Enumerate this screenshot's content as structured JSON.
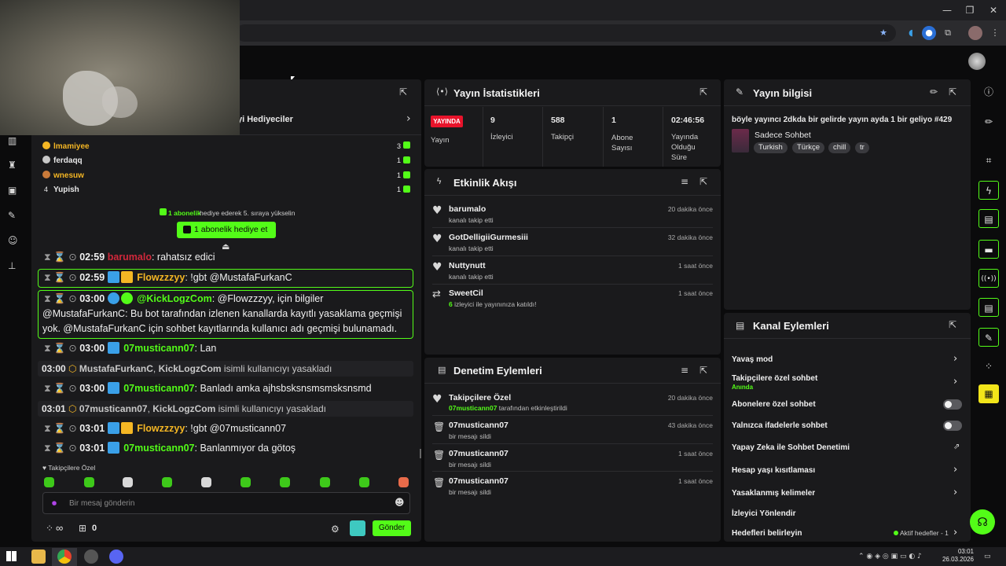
{
  "browser": {
    "minimize": "—",
    "maximize": "❐",
    "close": "✕"
  },
  "leaderboard": {
    "header": "yi Hediyeciler",
    "rows": [
      {
        "rank": "",
        "name": "lmamiyee",
        "count": "3"
      },
      {
        "rank": "",
        "name": "ferdaqq",
        "count": "1"
      },
      {
        "rank": "",
        "name": "wnesuw",
        "count": "1"
      },
      {
        "rank": "4",
        "name": "Yupish",
        "count": "1"
      }
    ],
    "promo_count": "1 abonelik",
    "promo_text": "hediye ederek 5. sıraya yükselin",
    "gift_button": "1 abonelik hediye et"
  },
  "chat": {
    "lines": [
      {
        "time": "02:59",
        "user": "barumalo",
        "msg": ": rahatsız edici"
      },
      {
        "time": "02:59",
        "user": "Flowzzzyy",
        "msg": ": !gbt @MustafaFurkanC"
      },
      {
        "time": "03:00",
        "user": "@KickLogzCom",
        "msg": ": @Flowzzzyy, için bilgiler @MustafaFurkanC: Bu bot tarafından izlenen kanallarda kayıtlı yasaklama geçmişi yok. @MustafaFurkanC için sohbet kayıtlarında kullanıcı adı geçmişi bulunamadı."
      },
      {
        "time": "03:00",
        "user": "07musticann07",
        "msg": ": Lan"
      },
      {
        "time": "03:00",
        "user": "07musticann07",
        "msg": ": Banladı amka ajhsbsksnsmsmsksnsmd"
      },
      {
        "time": "03:01",
        "user": "Flowzzzyy",
        "msg": ": !gbt @07musticann07"
      },
      {
        "time": "03:01",
        "user": "07musticann07",
        "msg": ": Banlanmıyor da götoş"
      }
    ],
    "sys1": {
      "time": "03:00",
      "a": "MustafaFurkanC",
      "b": "KickLogzCom",
      "text": "isimli kullanıcıyı yasakladı"
    },
    "sys2": {
      "time": "03:01",
      "a": "07musticann07",
      "b": "KickLogzCom",
      "text": "isimli kullanıcıyı yasakladı"
    },
    "followers_only": "Takipçilere Özel",
    "placeholder": "Bir mesaj gönderin",
    "infinity": "∞",
    "gift_count": "0",
    "send": "Gönder"
  },
  "stats": {
    "title": "Yayın İstatistikleri",
    "live": "YAYINDA",
    "live_label": "Yayın",
    "items": [
      {
        "value": "9",
        "label": "İzleyici"
      },
      {
        "value": "588",
        "label": "Takipçi"
      },
      {
        "value": "1",
        "label": "Abone Sayısı"
      },
      {
        "value": "02:46:56",
        "label": "Yayında Olduğu Süre"
      }
    ]
  },
  "activity": {
    "title": "Etkinlik Akışı",
    "items": [
      {
        "name": "barumalo",
        "sub": "kanalı takip etti",
        "time": "20 dakika önce"
      },
      {
        "name": "GotDelligiiGurmesiii",
        "sub": "kanalı takip etti",
        "time": "32 dakika önce"
      },
      {
        "name": "Nuttynutt",
        "sub": "kanalı takip etti",
        "time": "1 saat önce"
      },
      {
        "name": "SweetCil",
        "sub_num": "6",
        "sub": " izleyici ile yayınınıza katıldı!",
        "time": "1 saat önce"
      }
    ]
  },
  "moderation": {
    "title": "Denetim Eylemleri",
    "items": [
      {
        "name": "Takipçilere Özel",
        "actor": "07musticann07",
        "sub": " tarafından etkinleştirildi",
        "time": "20 dakika önce"
      },
      {
        "name": "07musticann07",
        "sub": "bir mesajı sildi",
        "time": "43 dakika önce"
      },
      {
        "name": "07musticann07",
        "sub": "bir mesajı sildi",
        "time": "1 saat önce"
      },
      {
        "name": "07musticann07",
        "sub": "bir mesajı sildi",
        "time": "1 saat önce"
      }
    ]
  },
  "info": {
    "title": "Yayın bilgisi",
    "stream_title": "böyle yayıncı 2dkda bir gelirde yayın ayda 1 bir geliyo #429",
    "category": "Sadece Sohbet",
    "tags": [
      "Turkish",
      "Türkçe",
      "chill",
      "tr"
    ]
  },
  "channel": {
    "title": "Kanal Eylemleri",
    "slow": "Yavaş mod",
    "followers": "Takipçilere özel sohbet",
    "followers_sub": "Anında",
    "subs": "Abonelere özel sohbet",
    "emotes": "Yalnızca ifadelerle sohbet",
    "ai": "Yapay Zeka ile Sohbet Denetimi",
    "age": "Hesap yaşı kısıtlaması",
    "banned": "Yasaklanmış kelimeler",
    "raid": "İzleyici Yönlendir",
    "goals": "Hedefleri belirleyin",
    "goals_active": "Aktif hedefler - 1"
  },
  "taskbar": {
    "time": "03:01",
    "date": "26.03.2026"
  },
  "colors": {
    "accent": "#53fc18",
    "live": "#e8132b",
    "gold": "#f4b624",
    "blue": "#3aa0e8"
  }
}
